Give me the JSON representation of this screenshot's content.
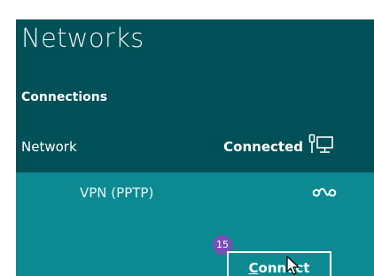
{
  "panel": {
    "title": "Networks",
    "section_label": "Connections",
    "network": {
      "name": "Network",
      "status": "Connected",
      "icon": "wired-network-icon"
    },
    "vpn": {
      "name": "VPN (PPTP)",
      "icon": "vpn-icon",
      "step_badge": "15",
      "connect_label": "Connect"
    }
  },
  "colors": {
    "panel_bg": "#005058",
    "selected_bg": "#0d8a91",
    "badge": "#7a4fb8"
  }
}
